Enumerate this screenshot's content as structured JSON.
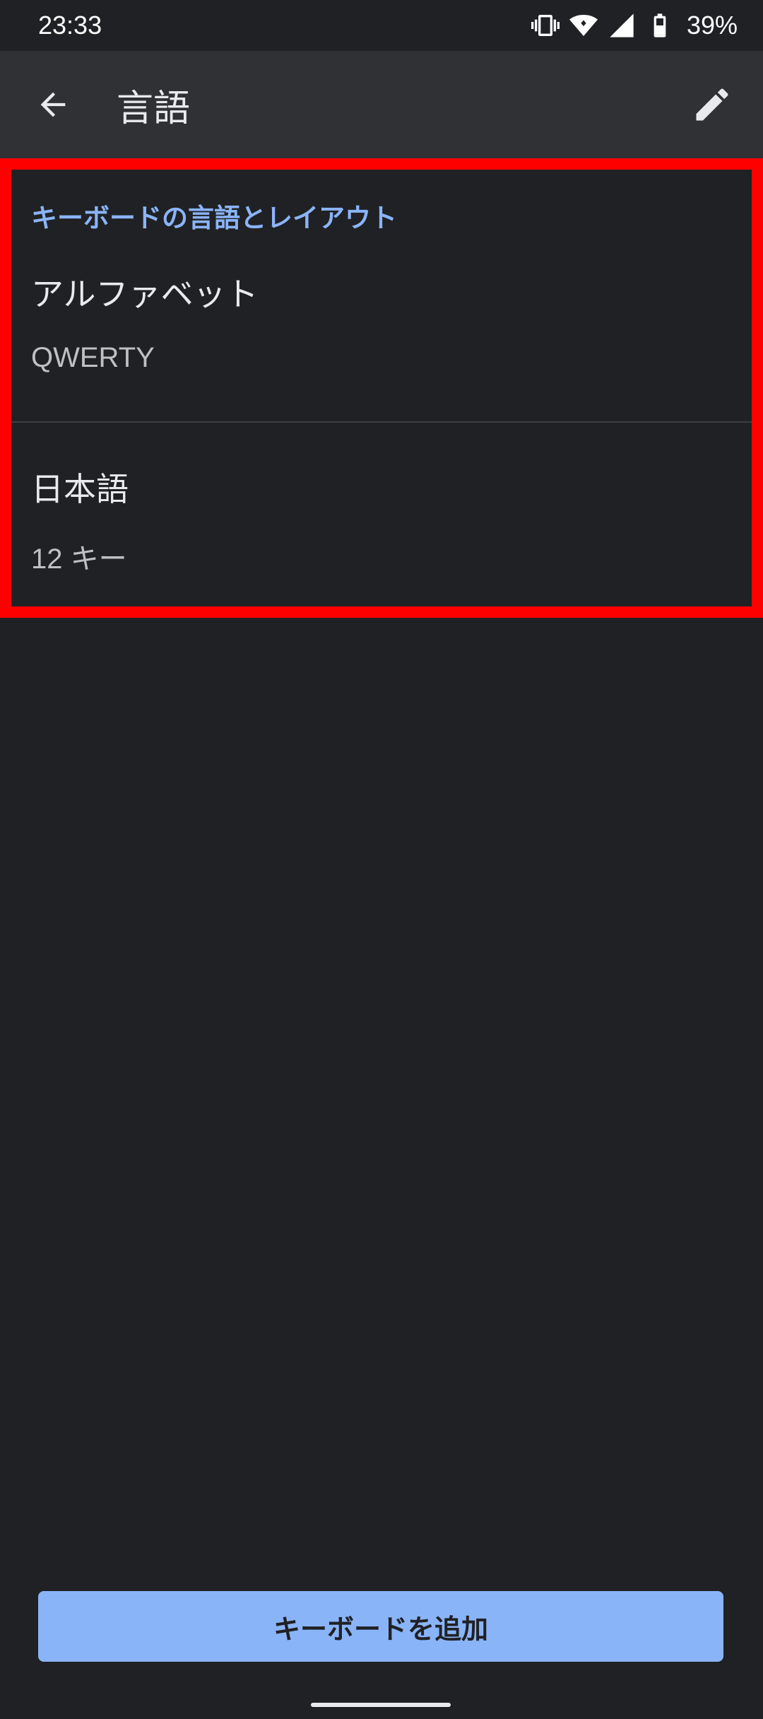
{
  "status_bar": {
    "time": "23:33",
    "battery_percent": "39%",
    "icons": [
      "vibrate-icon",
      "wifi-icon",
      "cell-signal-icon",
      "battery-icon"
    ]
  },
  "app_bar": {
    "title": "言語",
    "back_icon": "arrow-back-icon",
    "edit_icon": "pencil-icon"
  },
  "section": {
    "header": "キーボードの言語とレイアウト",
    "items": [
      {
        "title": "アルファベット",
        "subtitle": "QWERTY"
      },
      {
        "title": "日本語",
        "subtitle": "12 キー"
      }
    ]
  },
  "actions": {
    "add_keyboard_label": "キーボードを追加"
  },
  "colors": {
    "background": "#202124",
    "app_bar": "#303134",
    "accent": "#8ab4f8",
    "highlight_border": "#ff0000"
  }
}
